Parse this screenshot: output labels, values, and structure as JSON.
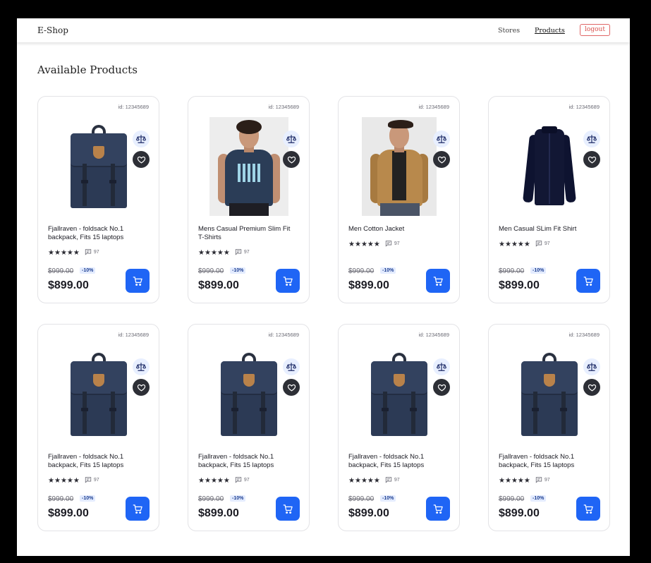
{
  "nav": {
    "brand": "E-Shop",
    "links": [
      "Stores",
      "Products"
    ],
    "active": "Products",
    "logout": "logout"
  },
  "page_title": "Available Products",
  "colors": {
    "accent": "#1f65f5",
    "logout": "#d9534f",
    "discount_bg": "#e4ecff"
  },
  "products": [
    {
      "id": "id: 12345689",
      "title": "Fjallraven - foldsack No.1 backpack, Fits 15 laptops",
      "image": "navy-backpack",
      "rating": 5,
      "reviews": "97",
      "old_price": "$999.00",
      "discount": "-10%",
      "price": "$899.00"
    },
    {
      "id": "id: 12345689",
      "title": "Mens Casual Premium Slim Fit T-Shirts",
      "image": "navy-tshirt-photo",
      "rating": 5,
      "reviews": "97",
      "old_price": "$999.00",
      "discount": "-10%",
      "price": "$899.00"
    },
    {
      "id": "id: 12345689",
      "title": "Men Cotton Jacket",
      "image": "tan-jacket-photo",
      "rating": 5,
      "reviews": "97",
      "old_price": "$999.00",
      "discount": "-10%",
      "price": "$899.00"
    },
    {
      "id": "id: 12345689",
      "title": "Men Casual SLim Fit Shirt",
      "image": "navy-dress-shirt",
      "rating": 5,
      "reviews": "97",
      "old_price": "$999.00",
      "discount": "-10%",
      "price": "$899.00"
    },
    {
      "id": "id: 12345689",
      "title": "Fjallraven - foldsack No.1 backpack, Fits 15 laptops",
      "image": "navy-backpack",
      "rating": 5,
      "reviews": "97",
      "old_price": "$999.00",
      "discount": "-10%",
      "price": "$899.00"
    },
    {
      "id": "id: 12345689",
      "title": "Fjallraven - foldsack No.1 backpack, Fits 15 laptops",
      "image": "navy-backpack",
      "rating": 5,
      "reviews": "97",
      "old_price": "$999.00",
      "discount": "-10%",
      "price": "$899.00"
    },
    {
      "id": "id: 12345689",
      "title": "Fjallraven - foldsack No.1 backpack, Fits 15 laptops",
      "image": "navy-backpack",
      "rating": 5,
      "reviews": "97",
      "old_price": "$999.00",
      "discount": "-10%",
      "price": "$899.00"
    },
    {
      "id": "id: 12345689",
      "title": "Fjallraven - foldsack No.1 backpack, Fits 15 laptops",
      "image": "navy-backpack",
      "rating": 5,
      "reviews": "97",
      "old_price": "$999.00",
      "discount": "-10%",
      "price": "$899.00"
    }
  ],
  "icons": {
    "compare": "scale-icon",
    "favorite": "heart-icon",
    "reviews": "comment-icon",
    "cart": "cart-icon",
    "rating": "star-icon"
  }
}
